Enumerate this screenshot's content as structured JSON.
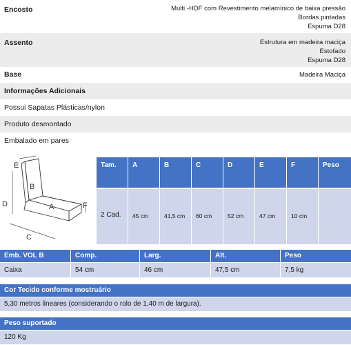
{
  "specs": {
    "encosto": {
      "label": "Encosto",
      "lines": [
        "Multi -HDF com Revestimento melamínico de baixa pressão",
        "Bordas pintadas",
        "Espuma D28"
      ]
    },
    "assento": {
      "label": "Assento",
      "lines": [
        "Estrutura em madeira maciça",
        "Estofado",
        "Espuma  D28"
      ]
    },
    "base": {
      "label": "Base",
      "value": "Madeira Maciça"
    }
  },
  "info": {
    "heading": "Informações Adicionais",
    "lines": [
      "Possui Sapatas Plásticas/nylon",
      "Produto desmontado",
      "Embalado em pares"
    ]
  },
  "diagram": {
    "labels": [
      "E",
      "B",
      "D",
      "A",
      "F",
      "C"
    ]
  },
  "dimensions": {
    "headers": [
      "Tam.",
      "A",
      "B",
      "C",
      "D",
      "E",
      "F",
      "Peso"
    ],
    "values": [
      "2 Cad.",
      "45 cm",
      "41,5 cm",
      "60 cm",
      "52 cm",
      "47 cm",
      "10 cm",
      ""
    ]
  },
  "packaging": {
    "headers": [
      "Emb.  VOL B",
      "Comp.",
      "Larg.",
      "Alt.",
      "Peso"
    ],
    "values": [
      "Caixa",
      "54 cm",
      "46 cm",
      "47,5 cm",
      "7,5 kg"
    ]
  },
  "fabric": {
    "heading": "Cor Tecido conforme mostruário",
    "value": "5,30 metros lineares (considerando o rolo de 1,40 m de largura)."
  },
  "weight": {
    "heading": "Peso suportado",
    "value": "120 Kg"
  },
  "colors": {
    "header_blue": "#4472c4",
    "cell_blue": "#cfd5ea",
    "stripe_gray": "#ececec"
  }
}
